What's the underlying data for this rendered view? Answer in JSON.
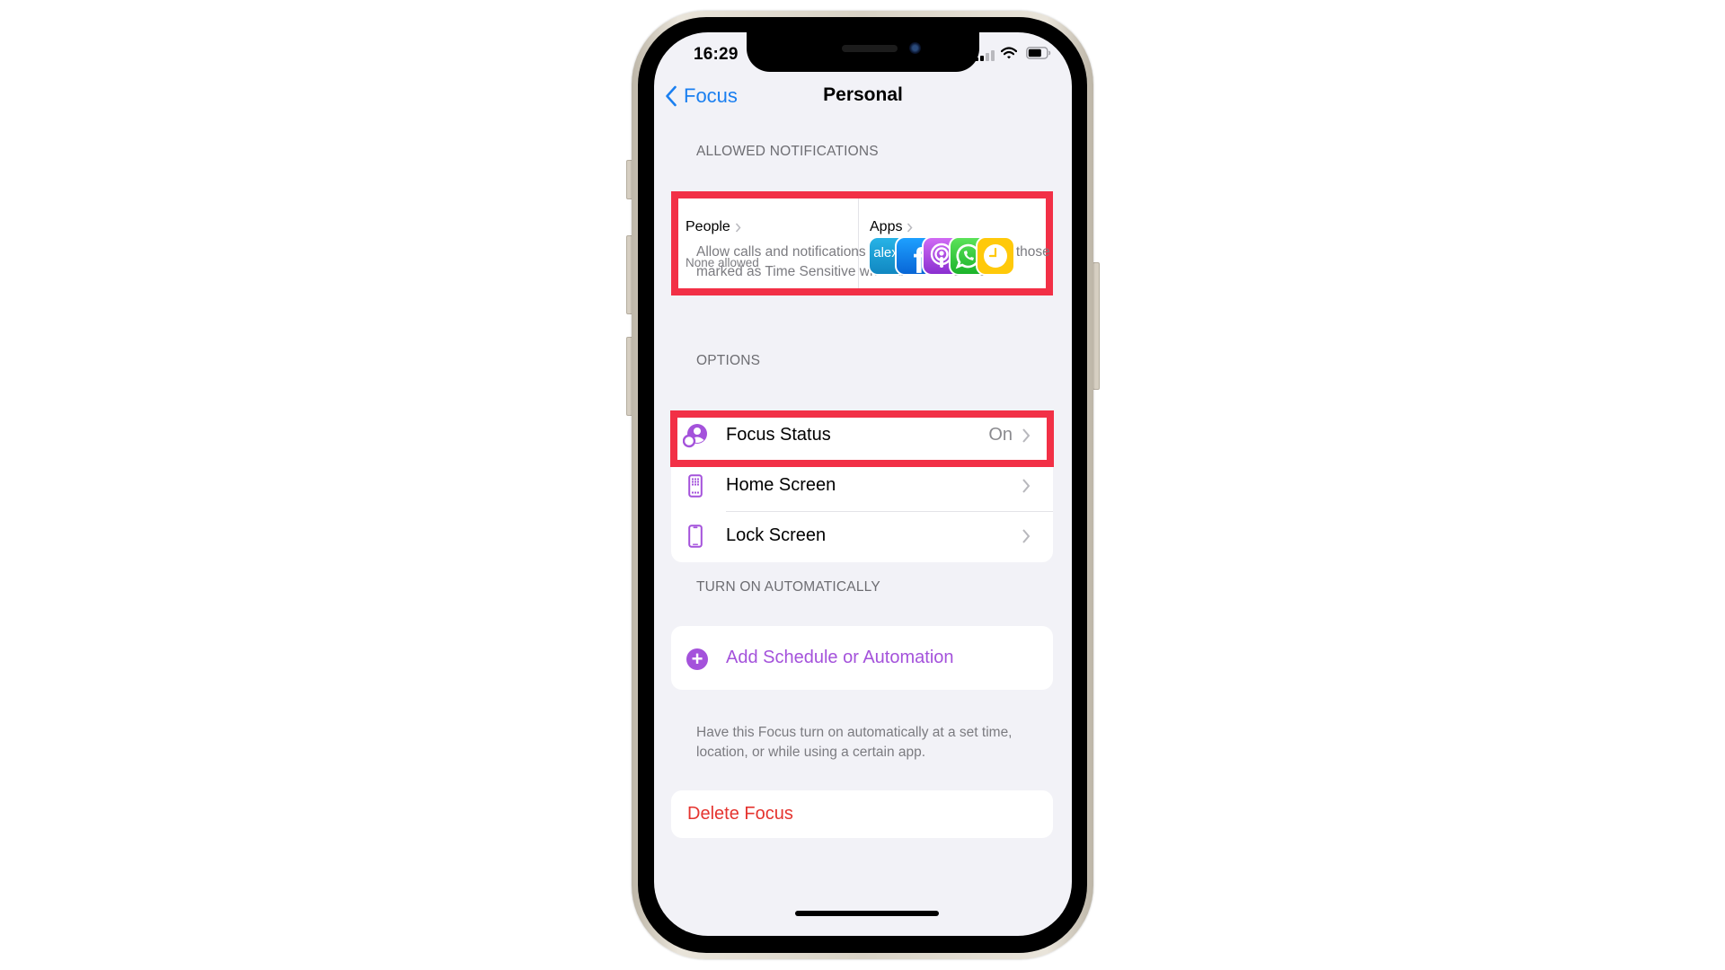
{
  "status_bar": {
    "time": "16:29",
    "location_icon": "location-arrow-icon",
    "signal_bars_active": 2,
    "signal_bars_total": 4,
    "wifi_icon": "wifi-icon",
    "battery_level": 0.7
  },
  "nav": {
    "back_label": "Focus",
    "title": "Personal"
  },
  "allowed_notifications": {
    "header": "ALLOWED NOTIFICATIONS",
    "people": {
      "label": "People",
      "value": "None allowed"
    },
    "apps": {
      "label": "Apps",
      "icons": [
        {
          "name": "alexa-app-icon",
          "text": "alex",
          "color": "#1aa1d6"
        },
        {
          "name": "facebook-app-icon",
          "text": "f",
          "color": "#1877f2"
        },
        {
          "name": "podcasts-app-icon",
          "text": "",
          "color": "#a23fd6"
        },
        {
          "name": "whatsapp-app-icon",
          "text": "",
          "color": "#2ecc40"
        },
        {
          "name": "clock-app-icon",
          "text": "",
          "color": "#ffc90a"
        }
      ]
    },
    "footer": "Allow calls and notifications from people, apps, and those marked as Time Sensitive when this Focus is on."
  },
  "options": {
    "header": "OPTIONS",
    "rows": [
      {
        "label": "Focus Status",
        "value": "On",
        "icon": "focus-status-icon"
      },
      {
        "label": "Home Screen",
        "value": "",
        "icon": "home-screen-icon"
      },
      {
        "label": "Lock Screen",
        "value": "",
        "icon": "lock-screen-icon"
      }
    ]
  },
  "turn_on_automatically": {
    "header": "TURN ON AUTOMATICALLY",
    "add_label": "Add Schedule or Automation",
    "footer": "Have this Focus turn on automatically at a set time, location, or while using a certain app."
  },
  "delete_label": "Delete Focus",
  "colors": {
    "accent_blue": "#1a7ff0",
    "focus_purple": "#a452db",
    "destructive_red": "#e5342f",
    "highlight_red": "#f23046"
  }
}
